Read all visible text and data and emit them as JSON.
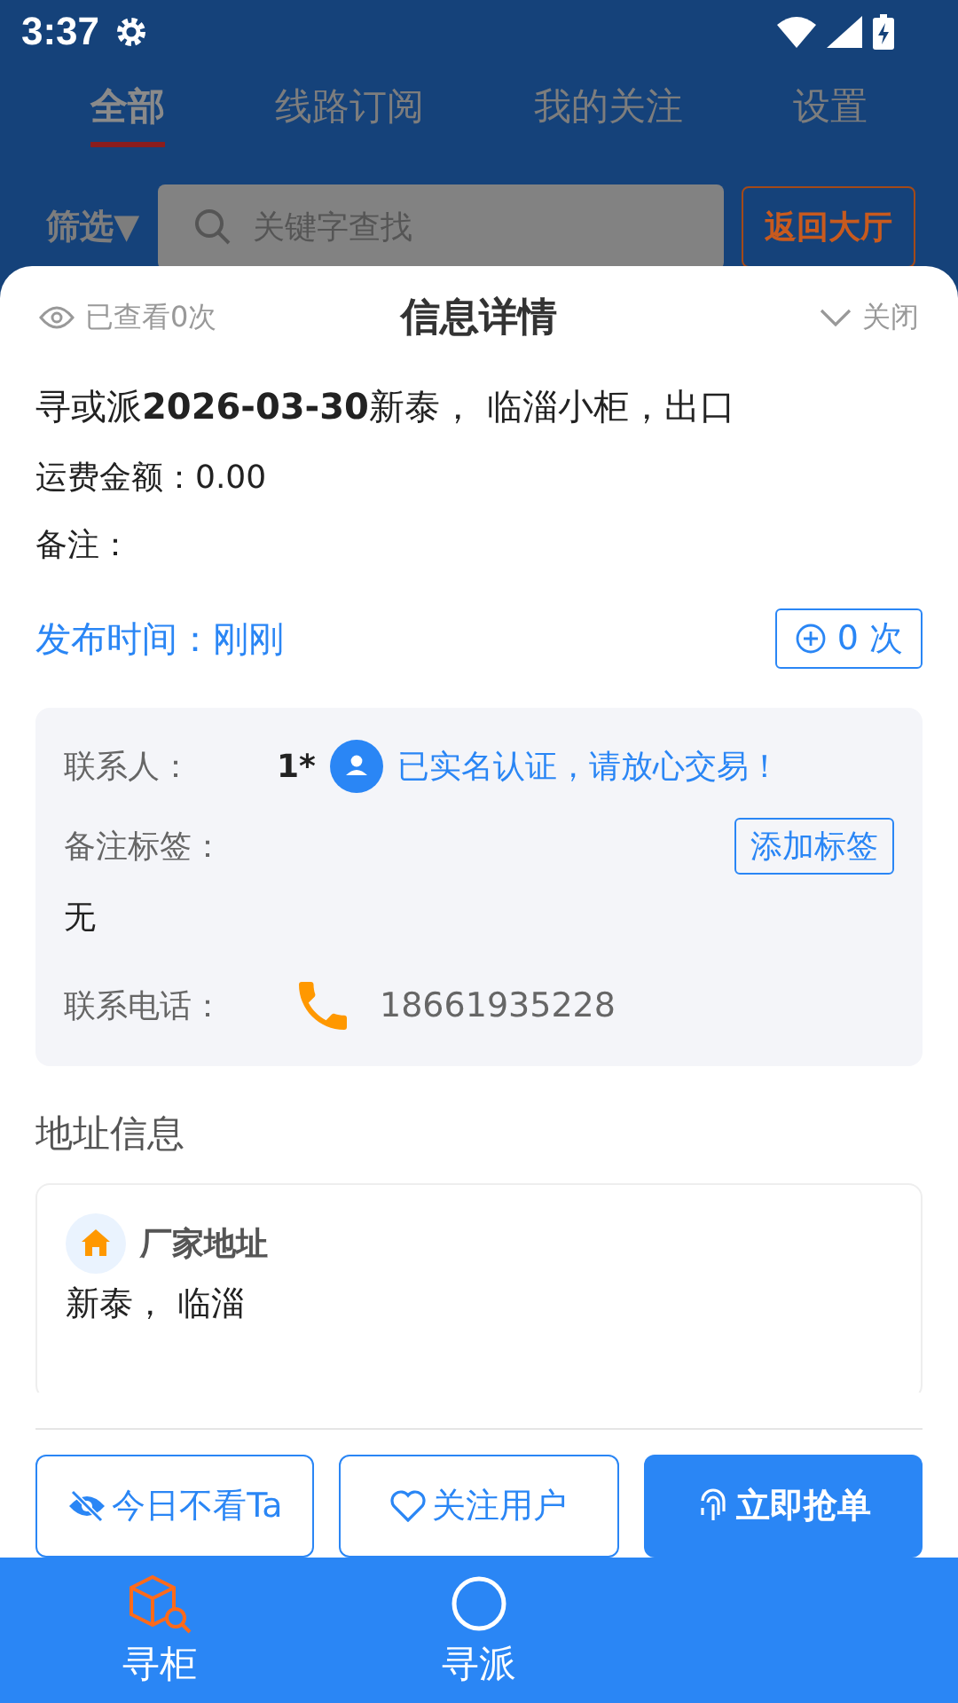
{
  "status_bar": {
    "time": "3:37"
  },
  "tabs": [
    {
      "label": "全部",
      "selected": true
    },
    {
      "label": "线路订阅",
      "selected": false
    },
    {
      "label": "我的关注",
      "selected": false
    },
    {
      "label": "设置",
      "selected": false
    }
  ],
  "filter": {
    "label": "筛选▼",
    "search_placeholder": "关键字查找",
    "back_button": "返回大厅"
  },
  "sheet": {
    "views": "已查看0次",
    "title": "信息详情",
    "close": "关闭",
    "headline": "寻或派**2026-03-30**新泰， 临淄小柜，出口",
    "fee": "运费金额：0.00",
    "note": "备注：",
    "publish_time": "发布时间：刚刚",
    "count_button": "0 次",
    "contact": {
      "contact_label": "联系人：",
      "contact_name": "1*",
      "verified": "已实名认证，请放心交易！",
      "tag_label": "备注标签：",
      "add_tag": "添加标签",
      "tag_value": "无",
      "phone_label": "联系电话：",
      "phone": "18661935228"
    },
    "address_heading": "地址信息",
    "addresses": [
      {
        "label": "厂家地址",
        "value": "新泰， 临淄"
      }
    ],
    "actions": [
      {
        "kind": "hide",
        "label": "今日不看Ta"
      },
      {
        "kind": "follow",
        "label": "关注用户"
      },
      {
        "kind": "grab",
        "label": "立即抢单"
      }
    ]
  },
  "bottom_nav": [
    {
      "label": "寻柜",
      "selected": true
    },
    {
      "label": "寻派",
      "selected": false
    }
  ]
}
